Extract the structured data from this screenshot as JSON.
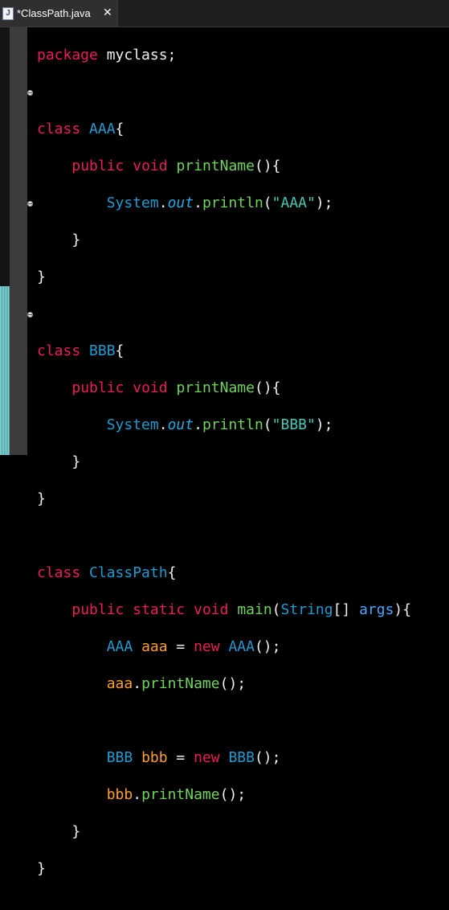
{
  "tab": {
    "icon_letter": "J",
    "title": "*ClassPath.java",
    "close": "✕"
  },
  "code": {
    "package_kw": "package",
    "package_name": " myclass;",
    "class_kw": "class",
    "public_kw": "public",
    "static_kw": "static",
    "void_kw": "void",
    "new_kw": "new",
    "class1": "AAA",
    "class2": "BBB",
    "class3": "ClassPath",
    "method": "printName",
    "main": "main",
    "system": "System",
    "out": "out",
    "println": "println",
    "str_aaa": "\"AAA\"",
    "str_bbb": "\"BBB\"",
    "string_type": "String",
    "args": "args",
    "var_aaa": "aaa",
    "var_bbb": "bbb"
  }
}
